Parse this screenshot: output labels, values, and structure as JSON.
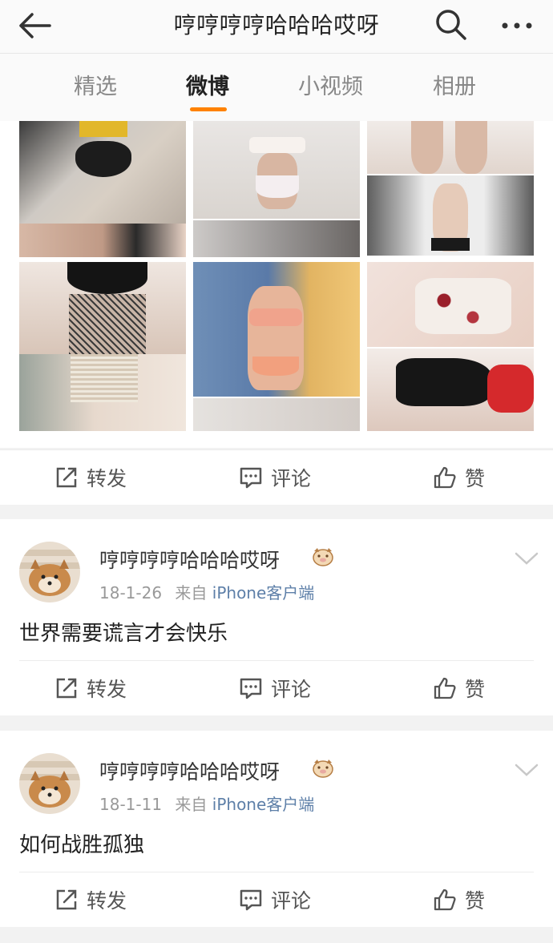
{
  "header": {
    "title": "哼哼哼哼哈哈哈哎呀",
    "back_icon": "back-arrow-icon",
    "search_icon": "search-icon",
    "more_icon": "more-dots-icon"
  },
  "tabs": [
    {
      "label": "精选",
      "active": false
    },
    {
      "label": "微博",
      "active": true
    },
    {
      "label": "小视频",
      "active": false
    },
    {
      "label": "相册",
      "active": false
    }
  ],
  "colors": {
    "accent": "#ff8200",
    "source_link": "#5d7fa8",
    "bg": "#f2f2f2"
  },
  "actions": {
    "repost": "转发",
    "comment": "评论",
    "like": "赞"
  },
  "posts": [
    {
      "username": "哼哼哼哼哈哈哈哎呀",
      "date": "18-1-26",
      "from_label": "来自",
      "source": "iPhone客户端",
      "text": "世界需要谎言才会快乐"
    },
    {
      "username": "哼哼哼哼哈哈哈哎呀",
      "date": "18-1-11",
      "from_label": "来自",
      "source": "iPhone客户端",
      "text": "如何战胜孤独"
    }
  ]
}
